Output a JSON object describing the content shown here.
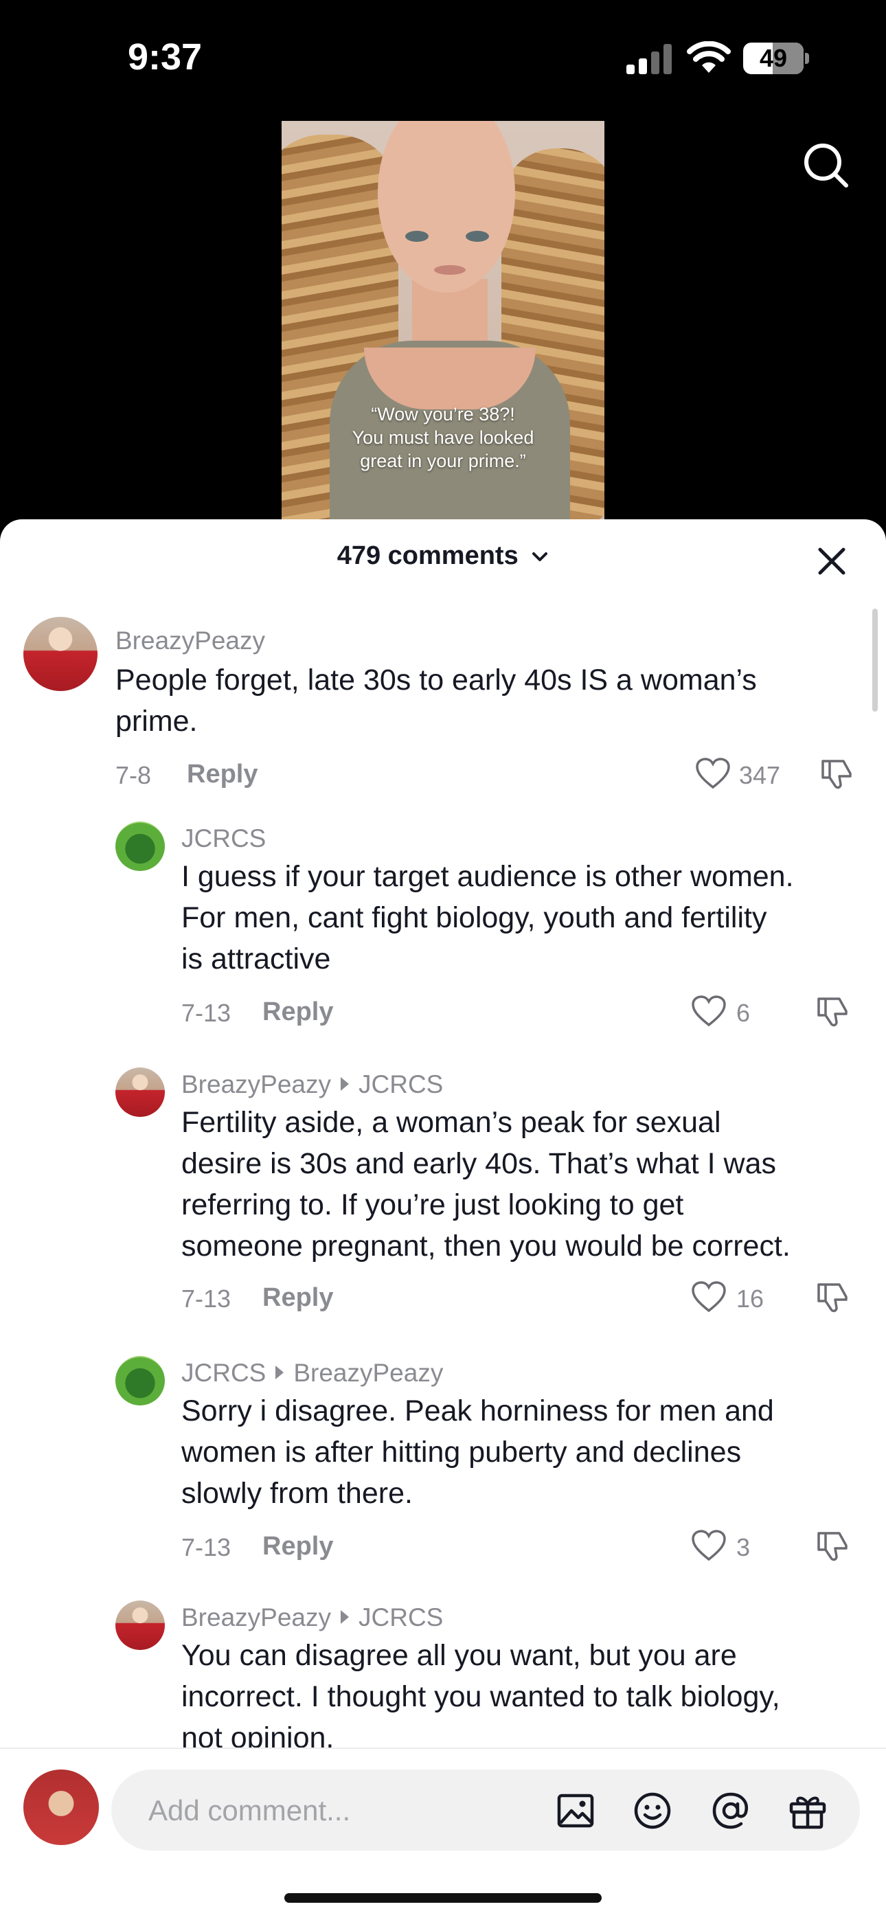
{
  "status_bar": {
    "time": "9:37",
    "battery": "49"
  },
  "video": {
    "caption_lines": [
      "“Wow you’re 38?!",
      "You must have looked",
      "great in your prime.”"
    ]
  },
  "header": {
    "comment_count": "479 comments"
  },
  "comments": [
    {
      "username": "BreazyPeazy",
      "reply_to": "",
      "text_lines": [
        "People forget, late 30s to early 40s IS a woman’s",
        "prime."
      ],
      "date": "7-8",
      "reply_label": "Reply",
      "likes": "347"
    },
    {
      "username": "JCRCS",
      "reply_to": "",
      "text_lines": [
        "I guess if your target audience is other women.",
        "For men, cant fight biology, youth and fertility",
        "is attractive"
      ],
      "date": "7-13",
      "reply_label": "Reply",
      "likes": "6"
    },
    {
      "username": "BreazyPeazy",
      "reply_to": "JCRCS",
      "text_lines": [
        "Fertility aside, a woman’s peak for sexual",
        "desire is 30s and early 40s. That’s what I was",
        "referring to. If you’re just looking to get",
        "someone pregnant, then you would be correct."
      ],
      "date": "7-13",
      "reply_label": "Reply",
      "likes": "16"
    },
    {
      "username": "JCRCS",
      "reply_to": "BreazyPeazy",
      "text_lines": [
        "Sorry i disagree. Peak horniness for men and",
        "women is after hitting puberty and declines",
        "slowly from there."
      ],
      "date": "7-13",
      "reply_label": "Reply",
      "likes": "3"
    },
    {
      "username": "BreazyPeazy",
      "reply_to": "JCRCS",
      "text_lines": [
        "You can disagree all you want, but you are",
        "incorrect. I thought you wanted to talk biology,",
        "not opinion."
      ]
    }
  ],
  "composer": {
    "placeholder": "Add comment..."
  },
  "icons": {
    "search": "search-icon",
    "close": "close-icon",
    "like": "heart-icon",
    "dislike": "thumbs-down-icon",
    "image": "image-icon",
    "emoji": "emoji-icon",
    "mention": "at-sign-icon",
    "gift": "gift-icon"
  }
}
